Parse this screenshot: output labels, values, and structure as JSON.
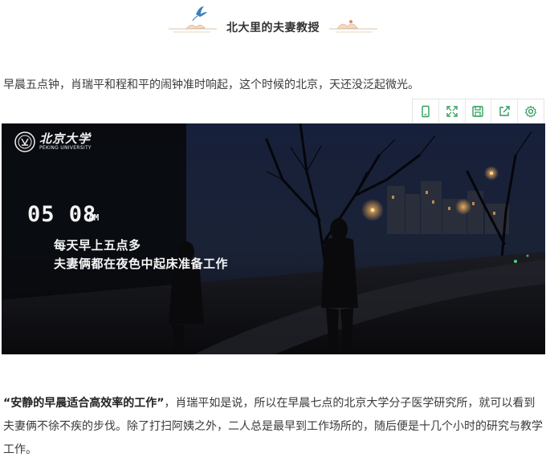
{
  "banner": {
    "title": "北大里的夫妻教授"
  },
  "paragraphs": {
    "p1": "早晨五点钟，肖瑞平和程和平的闹钟准时响起，这个时候的北京，天还没泛起微光。",
    "p2_quote": "“安静的早晨适合高效率的工作”",
    "p2_rest": "，肖瑞平如是说，所以在早晨七点的北京大学分子医学研究所，就可以看到夫妻俩不徐不疾的步伐。除了打扫阿姨之外，二人总是最早到工作场所的，随后便是十几个小时的研究与教学工作。"
  },
  "toolbar": {
    "icons": [
      "mobile-icon",
      "fullscreen-icon",
      "save-icon",
      "share-icon",
      "settings-icon"
    ],
    "accent_color": "#2e9e5b"
  },
  "video": {
    "logo_cn": "北京大学",
    "logo_en": "PEKING UNIVERSITY",
    "time": "05 08",
    "ampm": "AM",
    "subtitle_1": "每天早上五点多",
    "subtitle_2": "夫妻俩都在夜色中起床准备工作"
  }
}
